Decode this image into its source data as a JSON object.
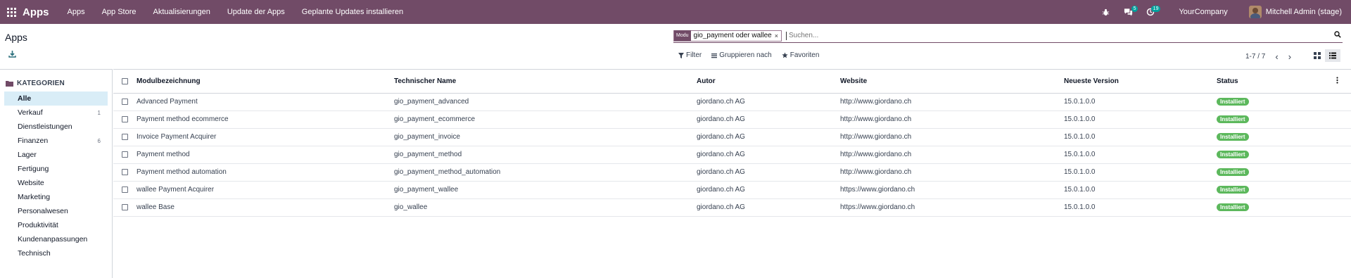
{
  "navbar": {
    "brand": "Apps",
    "menu": [
      "Apps",
      "App Store",
      "Aktualisierungen",
      "Update der Apps",
      "Geplante Updates installieren"
    ],
    "messages_badge": "5",
    "activities_badge": "19",
    "company": "YourCompany",
    "user": "Mitchell Admin (stage)"
  },
  "breadcrumb": "Apps",
  "search": {
    "facet_label": "Modu",
    "facet_value": "gio_payment oder wallee",
    "placeholder": "Suchen..."
  },
  "filters": {
    "filter_label": "Filter",
    "group_label": "Gruppieren nach",
    "favorites_label": "Favoriten"
  },
  "pager": "1-7 / 7",
  "sidebar": {
    "header": "KATEGORIEN",
    "items": [
      {
        "label": "Alle",
        "count": ""
      },
      {
        "label": "Verkauf",
        "count": "1"
      },
      {
        "label": "Dienstleistungen",
        "count": ""
      },
      {
        "label": "Finanzen",
        "count": "6"
      },
      {
        "label": "Lager",
        "count": ""
      },
      {
        "label": "Fertigung",
        "count": ""
      },
      {
        "label": "Website",
        "count": ""
      },
      {
        "label": "Marketing",
        "count": ""
      },
      {
        "label": "Personalwesen",
        "count": ""
      },
      {
        "label": "Produktivität",
        "count": ""
      },
      {
        "label": "Kundenanpassungen",
        "count": ""
      },
      {
        "label": "Technisch",
        "count": ""
      }
    ]
  },
  "table": {
    "columns": [
      "Modulbezeichnung",
      "Technischer Name",
      "Autor",
      "Website",
      "Neueste Version",
      "Status"
    ],
    "rows": [
      [
        "Advanced Payment",
        "gio_payment_advanced",
        "giordano.ch AG",
        "http://www.giordano.ch",
        "15.0.1.0.0",
        "Installiert"
      ],
      [
        "Payment method ecommerce",
        "gio_payment_ecommerce",
        "giordano.ch AG",
        "http://www.giordano.ch",
        "15.0.1.0.0",
        "Installiert"
      ],
      [
        "Invoice Payment Acquirer",
        "gio_payment_invoice",
        "giordano.ch AG",
        "http://www.giordano.ch",
        "15.0.1.0.0",
        "Installiert"
      ],
      [
        "Payment method",
        "gio_payment_method",
        "giordano.ch AG",
        "http://www.giordano.ch",
        "15.0.1.0.0",
        "Installiert"
      ],
      [
        "Payment method automation",
        "gio_payment_method_automation",
        "giordano.ch AG",
        "http://www.giordano.ch",
        "15.0.1.0.0",
        "Installiert"
      ],
      [
        "wallee Payment Acquirer",
        "gio_payment_wallee",
        "giordano.ch AG",
        "https://www.giordano.ch",
        "15.0.1.0.0",
        "Installiert"
      ],
      [
        "wallee Base",
        "gio_wallee",
        "giordano.ch AG",
        "https://www.giordano.ch",
        "15.0.1.0.0",
        "Installiert"
      ]
    ]
  },
  "colors": {
    "brand": "#714B67",
    "badge_installed": "#5cb85c",
    "active_category": "#d9edf7"
  }
}
